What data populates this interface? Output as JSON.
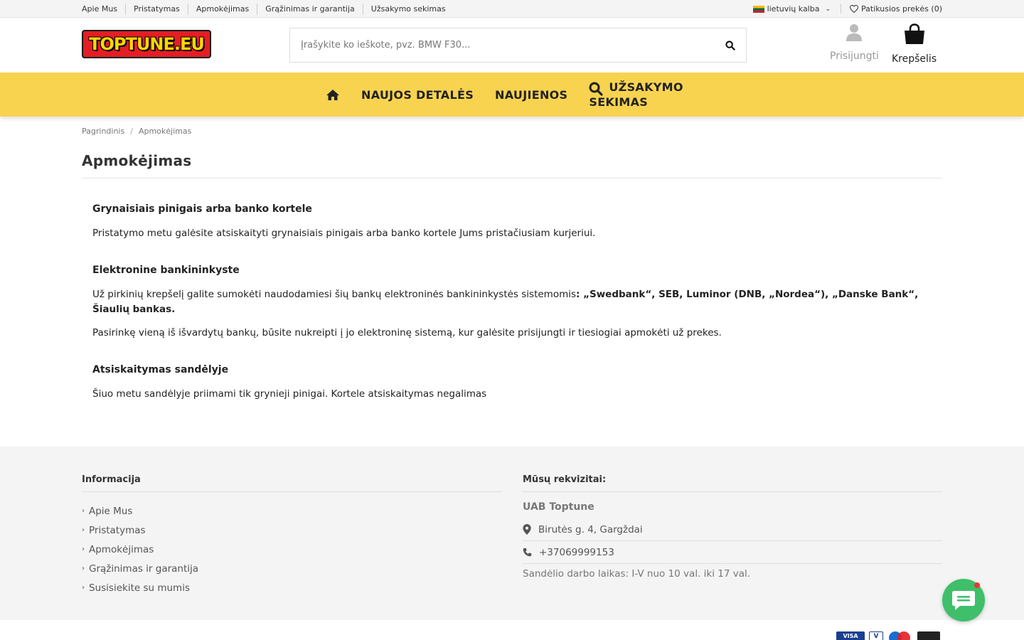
{
  "topbar": {
    "links": [
      "Apie Mus",
      "Pristatymas",
      "Apmokėjimas",
      "Grąžinimas ir garantija",
      "Užsakymo sekimas"
    ],
    "language": "lietuvių kalba",
    "wishlist": "Patikusios prekės (0)"
  },
  "header": {
    "logo_text": "TOPTUNE.EU",
    "search_placeholder": "Įrašykite ko ieškote, pvz. BMW F30...",
    "login_label": "Prisijungti",
    "cart_label": "Krepšelis"
  },
  "nav": {
    "items": [
      "NAUJOS DETALĖS",
      "NAUJIENOS"
    ],
    "tracking_line1": "UŽSAKYMO",
    "tracking_line2": "SEKIMAS"
  },
  "breadcrumb": [
    "Pagrindinis",
    "Apmokėjimas"
  ],
  "page": {
    "title": "Apmokėjimas",
    "sections": [
      {
        "heading": "Grynaisiais pinigais arba banko kortele",
        "text": "Pristatymo metu galėsite atsiskaityti grynaisiais pinigais arba banko kortele Jums pristačiusiam kurjeriui."
      },
      {
        "heading": "Elektronine bankininkyste",
        "text_prefix": "Už pirkinių krepšelį galite sumokėti naudodamiesi šių bankų elektroninės bankininkystės sistemomis",
        "text_bold": ": „Swedbank“, SEB, Luminor (DNB, „Nordea“), „Danske Bank“, Šiaulių bankas.",
        "text2": "Pasirinkę vieną iš išvardytų bankų, būsite nukreipti į jo elektroninę sistemą, kur galėsite prisijungti ir tiesiogiai apmokėti už prekes."
      },
      {
        "heading": "Atsiskaitymas sandėlyje",
        "text": "Šiuo metu sandėlyje priimami tik grynieji pinigai. Kortele atsiskaitymas negalimas"
      }
    ]
  },
  "footer": {
    "info_title": "Informacija",
    "info_links": [
      "Apie Mus",
      "Pristatymas",
      "Apmokėjimas",
      "Grąžinimas ir garantija",
      "Susisiekite su mumis"
    ],
    "details_title": "Mūsų rekvizitai:",
    "company": "UAB Toptune",
    "address": "Birutės g. 4, Gargždai",
    "phone": "+37069999153",
    "hours": "Sandėlio darbo laikas: I-V nuo 10 val. iki 17 val."
  },
  "payment_labels": {
    "visa": "VISA",
    "v": "V"
  },
  "colors": {
    "nav_bg": "#f7d350",
    "logo_bg": "#e31e24",
    "chat_bg": "#3fbf6a"
  }
}
